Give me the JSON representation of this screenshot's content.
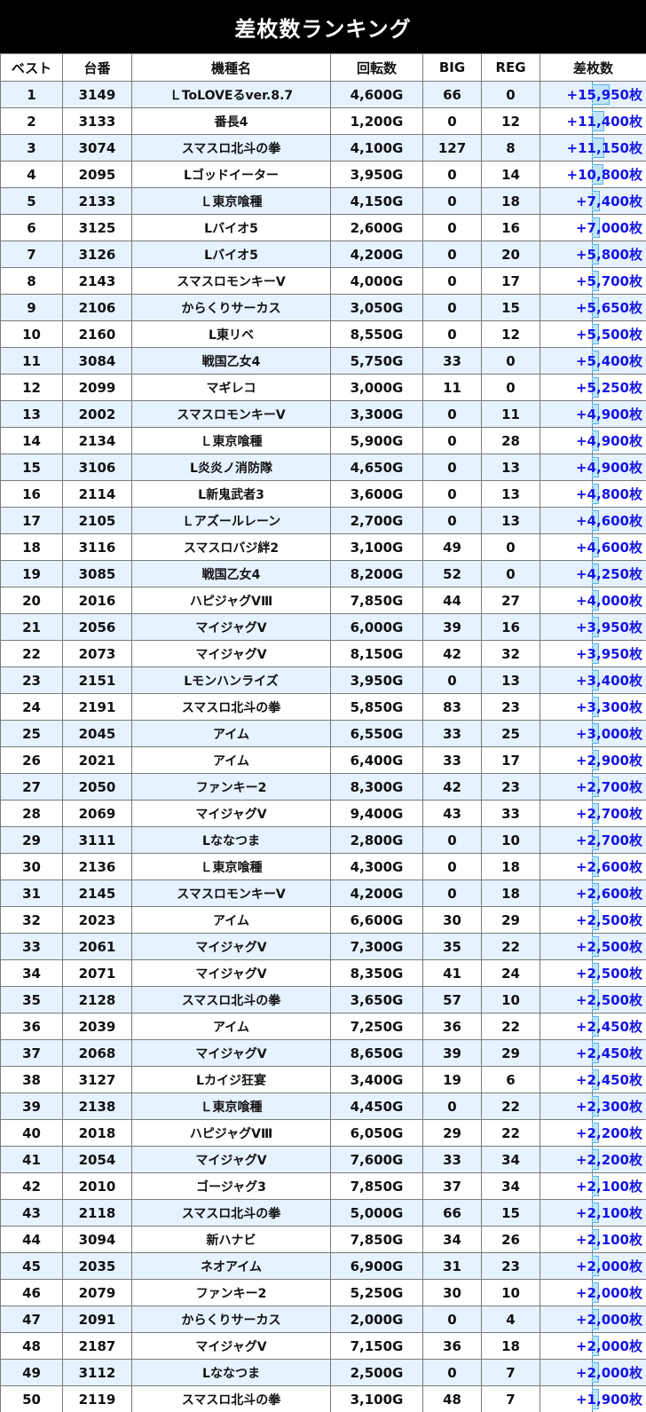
{
  "title": "差枚数ランキング",
  "columns": [
    "ベスト",
    "台番",
    "機種名",
    "回転数",
    "BIG",
    "REG",
    "差枚数"
  ],
  "accent_colors": {
    "header_bg": "#000000",
    "row_alt": "#e6f2ff",
    "diff_text": "#1515e6",
    "bar_fill": "#bfe4fb",
    "bar_border": "#5ab2e8"
  },
  "rows": [
    {
      "rank": "1",
      "machine_no": "3149",
      "model": "ＬToLOVEるver.8.7",
      "spins": "4,600G",
      "big": "66",
      "reg": "0",
      "diff": "+15,950枚",
      "diff_value": 15950
    },
    {
      "rank": "2",
      "machine_no": "3133",
      "model": "番長4",
      "spins": "1,200G",
      "big": "0",
      "reg": "12",
      "diff": "+11,400枚",
      "diff_value": 11400
    },
    {
      "rank": "3",
      "machine_no": "3074",
      "model": "スマスロ北斗の拳",
      "spins": "4,100G",
      "big": "127",
      "reg": "8",
      "diff": "+11,150枚",
      "diff_value": 11150
    },
    {
      "rank": "4",
      "machine_no": "2095",
      "model": "Lゴッドイーター",
      "spins": "3,950G",
      "big": "0",
      "reg": "14",
      "diff": "+10,800枚",
      "diff_value": 10800
    },
    {
      "rank": "5",
      "machine_no": "2133",
      "model": "Ｌ東京喰種",
      "spins": "4,150G",
      "big": "0",
      "reg": "18",
      "diff": "+7,400枚",
      "diff_value": 7400
    },
    {
      "rank": "6",
      "machine_no": "3125",
      "model": "Lバイオ5",
      "spins": "2,600G",
      "big": "0",
      "reg": "16",
      "diff": "+7,000枚",
      "diff_value": 7000
    },
    {
      "rank": "7",
      "machine_no": "3126",
      "model": "Lバイオ5",
      "spins": "4,200G",
      "big": "0",
      "reg": "20",
      "diff": "+5,800枚",
      "diff_value": 5800
    },
    {
      "rank": "8",
      "machine_no": "2143",
      "model": "スマスロモンキーV",
      "spins": "4,000G",
      "big": "0",
      "reg": "17",
      "diff": "+5,700枚",
      "diff_value": 5700
    },
    {
      "rank": "9",
      "machine_no": "2106",
      "model": "からくりサーカス",
      "spins": "3,050G",
      "big": "0",
      "reg": "15",
      "diff": "+5,650枚",
      "diff_value": 5650
    },
    {
      "rank": "10",
      "machine_no": "2160",
      "model": "L東リベ",
      "spins": "8,550G",
      "big": "0",
      "reg": "12",
      "diff": "+5,500枚",
      "diff_value": 5500
    },
    {
      "rank": "11",
      "machine_no": "3084",
      "model": "戦国乙女4",
      "spins": "5,750G",
      "big": "33",
      "reg": "0",
      "diff": "+5,400枚",
      "diff_value": 5400
    },
    {
      "rank": "12",
      "machine_no": "2099",
      "model": "マギレコ",
      "spins": "3,000G",
      "big": "11",
      "reg": "0",
      "diff": "+5,250枚",
      "diff_value": 5250
    },
    {
      "rank": "13",
      "machine_no": "2002",
      "model": "スマスロモンキーV",
      "spins": "3,300G",
      "big": "0",
      "reg": "11",
      "diff": "+4,900枚",
      "diff_value": 4900
    },
    {
      "rank": "14",
      "machine_no": "2134",
      "model": "Ｌ東京喰種",
      "spins": "5,900G",
      "big": "0",
      "reg": "28",
      "diff": "+4,900枚",
      "diff_value": 4900
    },
    {
      "rank": "15",
      "machine_no": "3106",
      "model": "L炎炎ノ消防隊",
      "spins": "4,650G",
      "big": "0",
      "reg": "13",
      "diff": "+4,900枚",
      "diff_value": 4900
    },
    {
      "rank": "16",
      "machine_no": "2114",
      "model": "L新鬼武者3",
      "spins": "3,600G",
      "big": "0",
      "reg": "13",
      "diff": "+4,800枚",
      "diff_value": 4800
    },
    {
      "rank": "17",
      "machine_no": "2105",
      "model": "Ｌアズールレーン",
      "spins": "2,700G",
      "big": "0",
      "reg": "13",
      "diff": "+4,600枚",
      "diff_value": 4600
    },
    {
      "rank": "18",
      "machine_no": "3116",
      "model": "スマスロバジ絆2",
      "spins": "3,100G",
      "big": "49",
      "reg": "0",
      "diff": "+4,600枚",
      "diff_value": 4600
    },
    {
      "rank": "19",
      "machine_no": "3085",
      "model": "戦国乙女4",
      "spins": "8,200G",
      "big": "52",
      "reg": "0",
      "diff": "+4,250枚",
      "diff_value": 4250
    },
    {
      "rank": "20",
      "machine_no": "2016",
      "model": "ハピジャグVⅢ",
      "spins": "7,850G",
      "big": "44",
      "reg": "27",
      "diff": "+4,000枚",
      "diff_value": 4000
    },
    {
      "rank": "21",
      "machine_no": "2056",
      "model": "マイジャグV",
      "spins": "6,000G",
      "big": "39",
      "reg": "16",
      "diff": "+3,950枚",
      "diff_value": 3950
    },
    {
      "rank": "22",
      "machine_no": "2073",
      "model": "マイジャグV",
      "spins": "8,150G",
      "big": "42",
      "reg": "32",
      "diff": "+3,950枚",
      "diff_value": 3950
    },
    {
      "rank": "23",
      "machine_no": "2151",
      "model": "Lモンハンライズ",
      "spins": "3,950G",
      "big": "0",
      "reg": "13",
      "diff": "+3,400枚",
      "diff_value": 3400
    },
    {
      "rank": "24",
      "machine_no": "2191",
      "model": "スマスロ北斗の拳",
      "spins": "5,850G",
      "big": "83",
      "reg": "23",
      "diff": "+3,300枚",
      "diff_value": 3300
    },
    {
      "rank": "25",
      "machine_no": "2045",
      "model": "アイム",
      "spins": "6,550G",
      "big": "33",
      "reg": "25",
      "diff": "+3,000枚",
      "diff_value": 3000
    },
    {
      "rank": "26",
      "machine_no": "2021",
      "model": "アイム",
      "spins": "6,400G",
      "big": "33",
      "reg": "17",
      "diff": "+2,900枚",
      "diff_value": 2900
    },
    {
      "rank": "27",
      "machine_no": "2050",
      "model": "ファンキー2",
      "spins": "8,300G",
      "big": "42",
      "reg": "23",
      "diff": "+2,700枚",
      "diff_value": 2700
    },
    {
      "rank": "28",
      "machine_no": "2069",
      "model": "マイジャグV",
      "spins": "9,400G",
      "big": "43",
      "reg": "33",
      "diff": "+2,700枚",
      "diff_value": 2700
    },
    {
      "rank": "29",
      "machine_no": "3111",
      "model": "Lななつま",
      "spins": "2,800G",
      "big": "0",
      "reg": "10",
      "diff": "+2,700枚",
      "diff_value": 2700
    },
    {
      "rank": "30",
      "machine_no": "2136",
      "model": "Ｌ東京喰種",
      "spins": "4,300G",
      "big": "0",
      "reg": "18",
      "diff": "+2,600枚",
      "diff_value": 2600
    },
    {
      "rank": "31",
      "machine_no": "2145",
      "model": "スマスロモンキーV",
      "spins": "4,200G",
      "big": "0",
      "reg": "18",
      "diff": "+2,600枚",
      "diff_value": 2600
    },
    {
      "rank": "32",
      "machine_no": "2023",
      "model": "アイム",
      "spins": "6,600G",
      "big": "30",
      "reg": "29",
      "diff": "+2,500枚",
      "diff_value": 2500
    },
    {
      "rank": "33",
      "machine_no": "2061",
      "model": "マイジャグV",
      "spins": "7,300G",
      "big": "35",
      "reg": "22",
      "diff": "+2,500枚",
      "diff_value": 2500
    },
    {
      "rank": "34",
      "machine_no": "2071",
      "model": "マイジャグV",
      "spins": "8,350G",
      "big": "41",
      "reg": "24",
      "diff": "+2,500枚",
      "diff_value": 2500
    },
    {
      "rank": "35",
      "machine_no": "2128",
      "model": "スマスロ北斗の拳",
      "spins": "3,650G",
      "big": "57",
      "reg": "10",
      "diff": "+2,500枚",
      "diff_value": 2500
    },
    {
      "rank": "36",
      "machine_no": "2039",
      "model": "アイム",
      "spins": "7,250G",
      "big": "36",
      "reg": "22",
      "diff": "+2,450枚",
      "diff_value": 2450
    },
    {
      "rank": "37",
      "machine_no": "2068",
      "model": "マイジャグV",
      "spins": "8,650G",
      "big": "39",
      "reg": "29",
      "diff": "+2,450枚",
      "diff_value": 2450
    },
    {
      "rank": "38",
      "machine_no": "3127",
      "model": "Lカイジ狂宴",
      "spins": "3,400G",
      "big": "19",
      "reg": "6",
      "diff": "+2,450枚",
      "diff_value": 2450
    },
    {
      "rank": "39",
      "machine_no": "2138",
      "model": "Ｌ東京喰種",
      "spins": "4,450G",
      "big": "0",
      "reg": "22",
      "diff": "+2,300枚",
      "diff_value": 2300
    },
    {
      "rank": "40",
      "machine_no": "2018",
      "model": "ハピジャグVⅢ",
      "spins": "6,050G",
      "big": "29",
      "reg": "22",
      "diff": "+2,200枚",
      "diff_value": 2200
    },
    {
      "rank": "41",
      "machine_no": "2054",
      "model": "マイジャグV",
      "spins": "7,600G",
      "big": "33",
      "reg": "34",
      "diff": "+2,200枚",
      "diff_value": 2200
    },
    {
      "rank": "42",
      "machine_no": "2010",
      "model": "ゴージャグ3",
      "spins": "7,850G",
      "big": "37",
      "reg": "34",
      "diff": "+2,100枚",
      "diff_value": 2100
    },
    {
      "rank": "43",
      "machine_no": "2118",
      "model": "スマスロ北斗の拳",
      "spins": "5,000G",
      "big": "66",
      "reg": "15",
      "diff": "+2,100枚",
      "diff_value": 2100
    },
    {
      "rank": "44",
      "machine_no": "3094",
      "model": "新ハナビ",
      "spins": "7,850G",
      "big": "34",
      "reg": "26",
      "diff": "+2,100枚",
      "diff_value": 2100
    },
    {
      "rank": "45",
      "machine_no": "2035",
      "model": "ネオアイム",
      "spins": "6,900G",
      "big": "31",
      "reg": "23",
      "diff": "+2,000枚",
      "diff_value": 2000
    },
    {
      "rank": "46",
      "machine_no": "2079",
      "model": "ファンキー2",
      "spins": "5,250G",
      "big": "30",
      "reg": "10",
      "diff": "+2,000枚",
      "diff_value": 2000
    },
    {
      "rank": "47",
      "machine_no": "2091",
      "model": "からくりサーカス",
      "spins": "2,000G",
      "big": "0",
      "reg": "4",
      "diff": "+2,000枚",
      "diff_value": 2000
    },
    {
      "rank": "48",
      "machine_no": "2187",
      "model": "マイジャグV",
      "spins": "7,150G",
      "big": "36",
      "reg": "18",
      "diff": "+2,000枚",
      "diff_value": 2000
    },
    {
      "rank": "49",
      "machine_no": "3112",
      "model": "Lななつま",
      "spins": "2,500G",
      "big": "0",
      "reg": "7",
      "diff": "+2,000枚",
      "diff_value": 2000
    },
    {
      "rank": "50",
      "machine_no": "2119",
      "model": "スマスロ北斗の拳",
      "spins": "3,100G",
      "big": "48",
      "reg": "7",
      "diff": "+1,900枚",
      "diff_value": 1900
    }
  ]
}
